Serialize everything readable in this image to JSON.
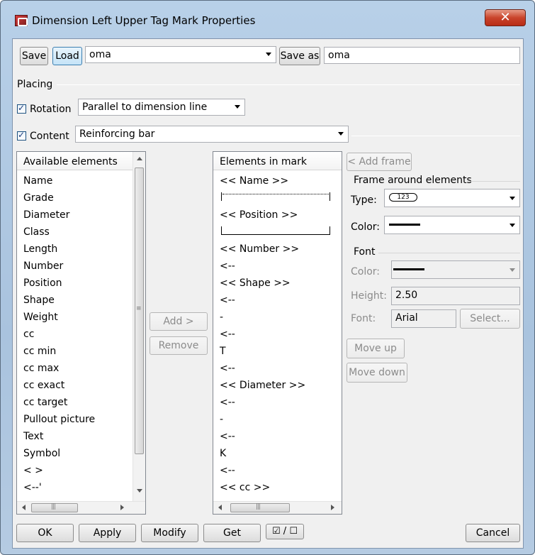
{
  "window": {
    "title": "Dimension Left Upper Tag Mark Properties",
    "close_glyph": "✕"
  },
  "toolbar": {
    "save_label": "Save",
    "load_label": "Load",
    "load_value": "oma",
    "save_as_label": "Save as",
    "save_as_value": "oma"
  },
  "placing": {
    "section_label": "Placing",
    "rotation_label": "Rotation",
    "rotation_checked": true,
    "rotation_value": "Parallel to dimension line",
    "content_label": "Content",
    "content_checked": true,
    "content_value": "Reinforcing bar"
  },
  "available": {
    "header": "Available elements",
    "items": [
      "Name",
      "Grade",
      "Diameter",
      "Class",
      "Length",
      "Number",
      "Position",
      "Shape",
      "Weight",
      "cc",
      "cc min",
      "cc max",
      "cc exact",
      "cc target",
      "Pullout picture",
      "Text",
      "Symbol",
      "< >",
      "<--'"
    ]
  },
  "middle_buttons": {
    "add_label": "Add >",
    "remove_label": "Remove"
  },
  "in_mark": {
    "header": "Elements in mark",
    "items": [
      "<< Name >>",
      "",
      "<< Position >>",
      "",
      "<< Number >>",
      "<--",
      "<< Shape >>",
      "<--",
      "-",
      "<--",
      "T",
      "<--",
      "<< Diameter >>",
      "<--",
      "-",
      "<--",
      "K",
      "<--",
      "<< cc >>"
    ]
  },
  "right_panel": {
    "add_frame_label": "< Add frame",
    "frame_group_label": "Frame around elements",
    "type_label": "Type:",
    "type_sample_text": "123",
    "color_label": "Color:",
    "font_group_label": "Font",
    "font_color_label": "Color:",
    "height_label": "Height:",
    "height_value": "2.50",
    "font_label": "Font:",
    "font_value": "Arial",
    "select_label": "Select...",
    "move_up_label": "Move up",
    "move_down_label": "Move down"
  },
  "footer": {
    "ok_label": "OK",
    "apply_label": "Apply",
    "modify_label": "Modify",
    "get_label": "Get",
    "toggle_label": "☑ / ☐",
    "cancel_label": "Cancel"
  }
}
